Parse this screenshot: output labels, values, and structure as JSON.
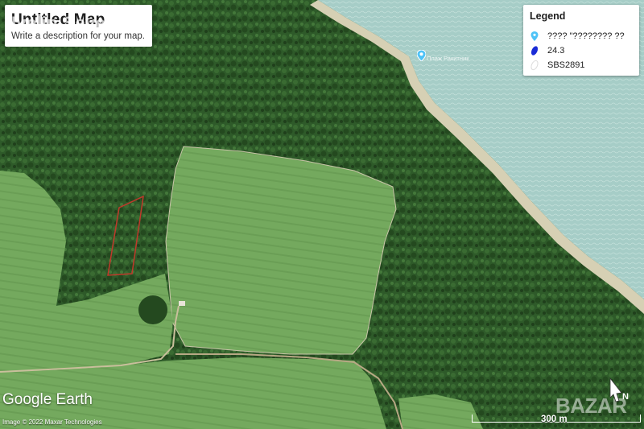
{
  "map": {
    "title": "Untitled Map",
    "description": "Write a description for your map.",
    "watermark_top": "Ivelin Severus",
    "place_label": "Плаж Ракитник"
  },
  "legend": {
    "title": "Legend",
    "items": [
      {
        "icon": "placemark-pin-icon",
        "label": "???? \"???????? ??",
        "color": "#4fc3f7"
      },
      {
        "icon": "polygon-icon",
        "label": "24.3",
        "color": "#1a2bd6"
      },
      {
        "icon": "empty-polygon-icon",
        "label": "SBS2891",
        "color": "#ffffff"
      }
    ]
  },
  "branding": {
    "logo": "Google Earth",
    "copyright": "Image © 2022 Maxar Technologies",
    "watermark_corner": "BAZAR"
  },
  "scale": {
    "label": "300 m"
  },
  "compass": {
    "label": "N"
  },
  "colors": {
    "forest": "#2f5a2a",
    "field": "#6fa25a",
    "sea": "#a9cfc8",
    "beach": "#d8d2b8",
    "parcel_outline": "#c0392b"
  }
}
